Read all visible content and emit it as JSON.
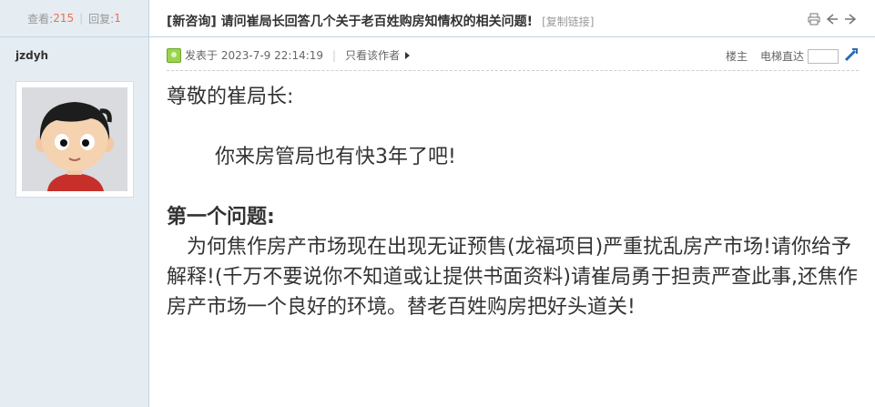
{
  "stats": {
    "views_label": "查看:",
    "views": "215",
    "replies_label": "回复:",
    "replies": "1"
  },
  "author": {
    "name": "jzdyh"
  },
  "thread": {
    "title": "[新咨询] 请问崔局长回答几个关于老百姓购房知情权的相关问题!",
    "copy_link": "[复制链接]"
  },
  "post_meta": {
    "posted_prefix": "发表于",
    "datetime": "2023-7-9 22:14:19",
    "only_author": "只看该作者",
    "floor": "楼主",
    "jump_label": "电梯直达"
  },
  "content": {
    "greeting": "尊敬的崔局长:",
    "line1": "你来房管局也有快3年了吧!",
    "heading": "第一个问题:",
    "paragraph": "为何焦作房产市场现在出现无证预售(龙福项目)严重扰乱房产市场!请你给予解释!(千万不要说你不知道或让提供书面资料)请崔局勇于担责严查此事,还焦作房产市场一个良好的环境。替老百姓购房把好头道关!"
  },
  "icons": {
    "print": "print-icon",
    "prev": "prev-thread-icon",
    "next": "next-thread-icon",
    "online": "online-status-icon",
    "jump_go": "jump-go-icon"
  },
  "colors": {
    "accent_number": "#f26c4f",
    "left_bg": "#e5edf2",
    "border": "#c2d5e3"
  }
}
